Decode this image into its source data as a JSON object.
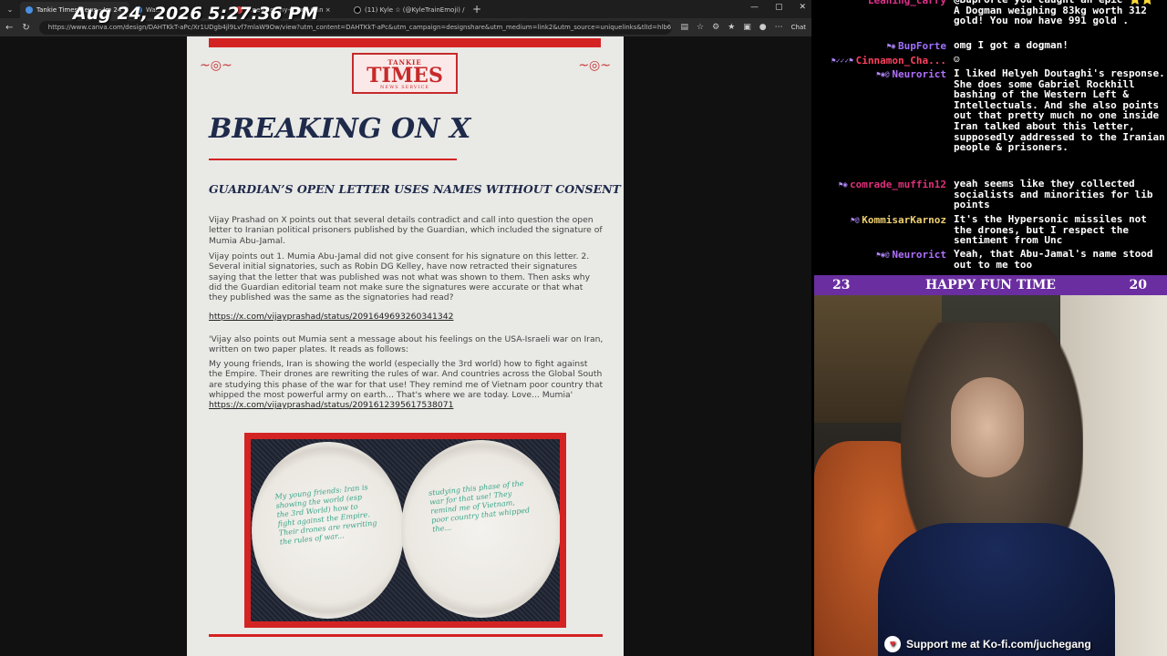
{
  "timestamp": "Aug 24, 2026 5:27:36 PM",
  "browser": {
    "tabs": [
      {
        "label": "Tankie Times News - Jm 24 ×",
        "active": true
      },
      {
        "label": "Wa...",
        "active": false
      },
      {
        "label": "...ne+Bo...ny+Few+Can ×",
        "active": false
      },
      {
        "label": "(11) Kyle ☆ (@KyleTrainEmoji) / X ×",
        "active": false
      }
    ],
    "new_tab": "+",
    "window_controls": [
      "—",
      "▢",
      "✕"
    ],
    "nav": {
      "back": "←",
      "refresh": "↻"
    },
    "url": "https://www.canva.com/design/DAHTKkT-aPc/Xr1UDgb4jl9Lvf7mlaW9Ow/view?utm_content=DAHTKkT-aPc&utm_campaign=designshare&utm_medium=link2&utm_source=uniquelinks&tlId=hlb6fd8...",
    "chat_button": "Chat"
  },
  "document": {
    "logo_top": "TANKIE",
    "logo_main": "TIMES",
    "logo_sub": "NEWS SERVICE",
    "headline": "BREAKING ON X",
    "subheadline": "GUARDIAN’S OPEN LETTER USES NAMES WITHOUT CONSENT",
    "paragraph1": "Vijay Prashad on X points out that several details contradict and call into question the open letter to Iranian political prisoners published by the Guardian, which included the signature of Mumia Abu-Jamal.",
    "paragraph2": "Vijay points out 1. Mumia Abu-Jamal did not give consent for his signature on this letter. 2. Several initial signatories, such as Robin DG Kelley, have now retracted their signatures saying that the letter that was published was not what was shown to them. Then asks why did the Guardian editorial team not make sure the signatures were accurate or that what they published was the same as the signatories had read?",
    "link1": "https://x.com/vijayprashad/status/2091649693260341342",
    "paragraph3": "'Vijay also points out Mumia sent a message about his feelings on the USA-Israeli war on Iran, written on two paper plates. It reads as follows:",
    "paragraph4": "My young friends, Iran is showing the world (especially the 3rd world) how to fight against the Empire. Their drones are rewriting the rules of war. And countries across the Global South are studying this phase of the war for that use! They remind me of Vietnam poor country that whipped the most powerful army on earth... That's where we are today. Love... Mumia'",
    "link2": "https://x.com/vijayprashad/status/2091612395617538071",
    "plate_left_text": "My young friends: Iran is showing the world (esp the 3rd World) how to fight against the Empire. Their drones are rewriting the rules of war...",
    "plate_right_text": "studying this phase of the war for that use! They remind me of Vietnam, poor country that whipped the..."
  },
  "chat": [
    {
      "user": "Leaning_carry",
      "color": "#e0308c",
      "badges": "",
      "text": "@BupForte you caught an epic ⭐⭐ A Dogman weighing 83kg worth 312 gold! You now have 991 gold ."
    },
    {
      "user": "BupForte",
      "color": "#a070ff",
      "badges": "⚑◉",
      "text": "omg I got a dogman!"
    },
    {
      "user": "Cinnamon_Cha...",
      "color": "#ff4060",
      "badges": "⚑✓✓✓⚑",
      "text": "☺"
    },
    {
      "user": "Neurorict",
      "color": "#b070ff",
      "badges": "⚑◉@",
      "text": "I liked Helyeh Doutaghi's response. She does some Gabriel Rockhill bashing of the Western Left & Intellectuals. And she also points out that pretty much no one inside Iran talked about this letter, supposedly addressed to the Iranian people & prisoners."
    },
    {
      "user": "comrade_muffin12",
      "color": "#e0307a",
      "badges": "⚑◉",
      "text": "yeah seems like they collected socialists and minorities for lib points"
    },
    {
      "user": "KommisarKarnoz",
      "color": "#f0d070",
      "badges": "⚑@",
      "text": "It's the Hypersonic missiles not the drones, but I respect the sentiment from Unc"
    },
    {
      "user": "Neurorict",
      "color": "#b070ff",
      "badges": "⚑◉@",
      "text": "Yeah, that Abu-Jamal's name stood out to me too"
    }
  ],
  "banner": {
    "left": "23",
    "center": "HAPPY FUN TIME",
    "right": "20"
  },
  "kofi": "Support me at Ko-fi.com/juchegang"
}
